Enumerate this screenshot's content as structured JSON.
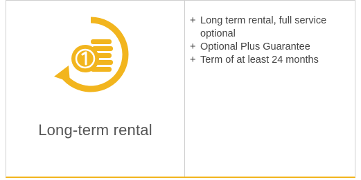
{
  "card": {
    "title": "Long-term rental",
    "icon": "coin-stack-rotation-icon",
    "accent_color": "#f2b51e",
    "features": [
      {
        "prefix": "+",
        "text": "Long term rental, full service optional"
      },
      {
        "prefix": "+",
        "text": "Optional Plus Guarantee"
      },
      {
        "prefix": "+",
        "text": "Term of at least 24 months"
      }
    ]
  }
}
